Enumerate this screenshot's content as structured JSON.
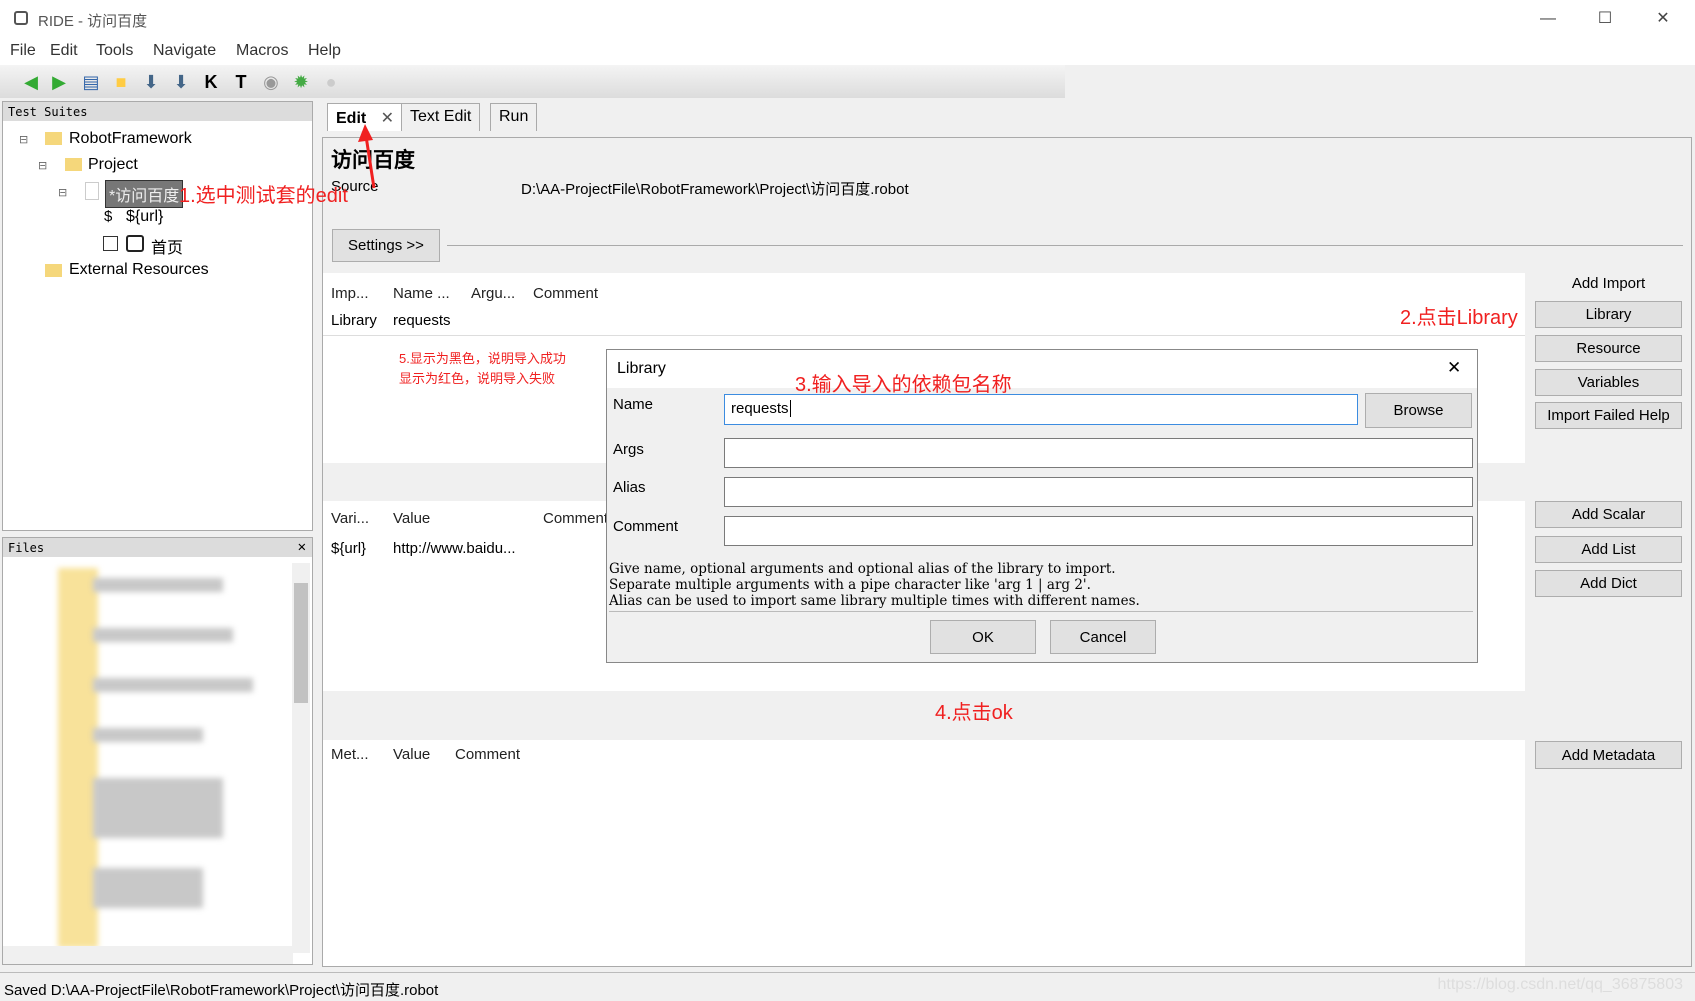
{
  "window": {
    "title": "RIDE - 访问百度",
    "minimize": "—",
    "maximize": "☐",
    "close": "✕"
  },
  "menu": [
    "File",
    "Edit",
    "Tools",
    "Navigate",
    "Macros",
    "Help"
  ],
  "toolbar_icons": [
    "back-icon",
    "forward-icon",
    "open-icon",
    "folder-icon",
    "save-icon",
    "save-all-icon",
    "keyword-search-icon",
    "test-search-icon",
    "run-icon",
    "debug-icon",
    "stop-icon"
  ],
  "test_suites": {
    "header": "Test Suites",
    "items": [
      "RobotFramework",
      "Project",
      "*访问百度",
      "${url}",
      "首页",
      "External Resources"
    ]
  },
  "files": {
    "header": "Files",
    "close": "✕"
  },
  "tabs": [
    {
      "label": "Edit",
      "close": "✕"
    },
    {
      "label": "Text Edit"
    },
    {
      "label": "Run"
    }
  ],
  "suite": {
    "title": "访问百度",
    "source_label": "Source",
    "source_path": "D:\\AA-ProjectFile\\RobotFramework\\Project\\访问百度.robot",
    "settings_button": "Settings >>"
  },
  "imports": {
    "headers": [
      "Imp...",
      "Name ...",
      "Argu...",
      "Comment"
    ],
    "rows": [
      [
        "Library",
        "requests",
        "",
        ""
      ]
    ]
  },
  "variables": {
    "headers": [
      "Vari...",
      "Value",
      "Comment"
    ],
    "rows": [
      [
        "${url}",
        "http://www.baidu...",
        ""
      ]
    ]
  },
  "metadata": {
    "headers": [
      "Met...",
      "Value",
      "Comment"
    ]
  },
  "side_buttons": {
    "add_import": "Add Import",
    "library": "Library",
    "resource": "Resource",
    "variables": "Variables",
    "import_failed_help": "Import Failed Help",
    "add_scalar": "Add Scalar",
    "add_list": "Add List",
    "add_dict": "Add Dict",
    "add_metadata": "Add Metadata"
  },
  "dialog": {
    "title": "Library",
    "close": "✕",
    "name_label": "Name",
    "name_value": "requests",
    "browse": "Browse",
    "args_label": "Args",
    "alias_label": "Alias",
    "comment_label": "Comment",
    "help": [
      "Give name, optional arguments and optional alias of the library to import.",
      "Separate multiple arguments with a pipe character like 'arg 1 | arg 2'.",
      "Alias can be used to import same library multiple times with different names."
    ],
    "ok": "OK",
    "cancel": "Cancel"
  },
  "annotations": {
    "a1": "1.选中测试套的edit",
    "a2": "2.点击Library",
    "a3": "3.输入导入的依赖包名称",
    "a4": "4.点击ok",
    "a5_line1": "5.显示为黑色，说明导入成功",
    "a5_line2": "显示为红色，说明导入失败",
    "color": "#f02020"
  },
  "status": "Saved D:\\AA-ProjectFile\\RobotFramework\\Project\\访问百度.robot",
  "watermark": "https://blog.csdn.net/qq_36875803"
}
